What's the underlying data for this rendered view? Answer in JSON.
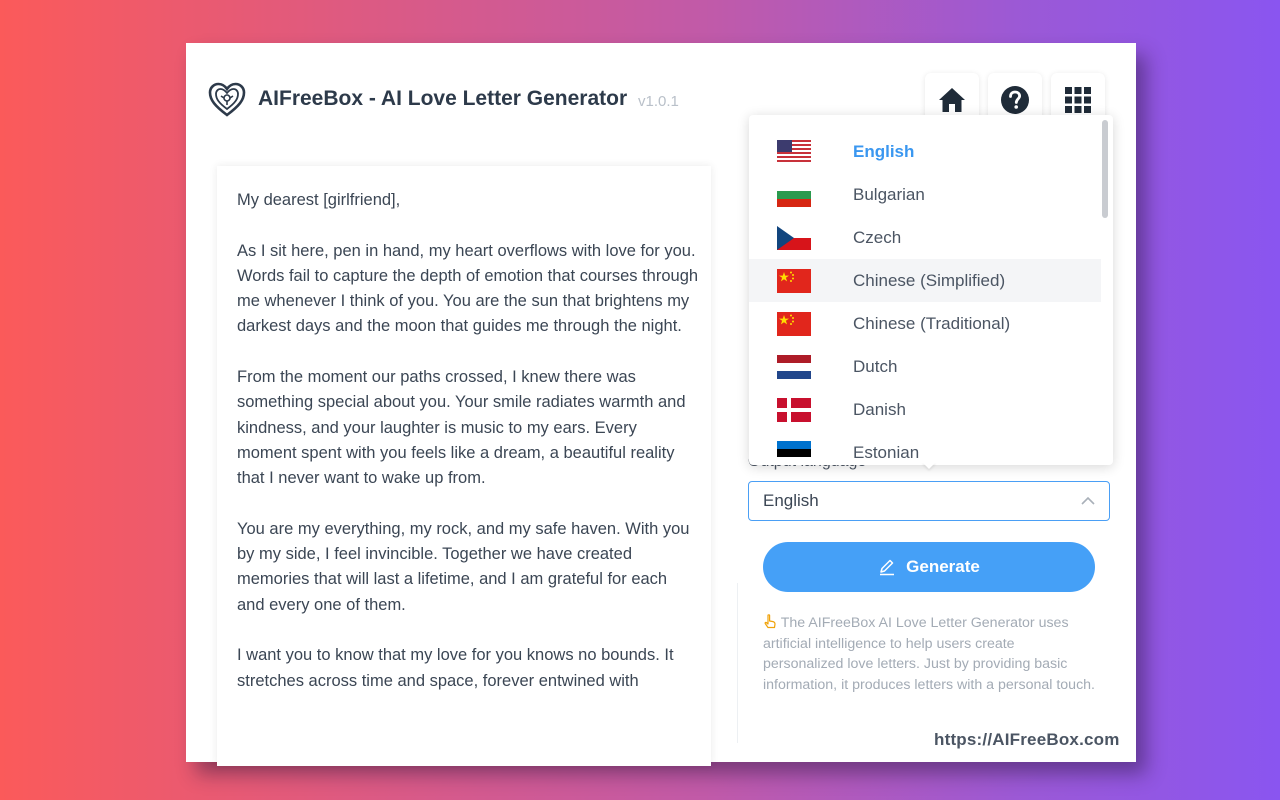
{
  "app": {
    "title": "AIFreeBox - AI Love Letter Generator",
    "version": "v1.0.1",
    "footer_url": "https://AIFreeBox.com"
  },
  "toolbar": {
    "home_icon": "home-icon",
    "help_icon": "help-icon",
    "apps_icon": "apps-grid-icon"
  },
  "letter": {
    "paragraphs": [
      "My dearest [girlfriend],",
      "As I sit here, pen in hand, my heart overflows with love for you. Words fail to capture the depth of emotion that courses through me whenever I think of you. You are the sun that brightens my darkest days and the moon that guides me through the night.",
      "From the moment our paths crossed, I knew there was something special about you. Your smile radiates warmth and kindness, and your laughter is music to my ears. Every moment spent with you feels like a dream, a beautiful reality that I never want to wake up from.",
      "You are my everything, my rock, and my safe haven. With you by my side, I feel invincible. Together we have created memories that will last a lifetime, and I am grateful for each and every one of them.",
      "I want you to know that my love for you knows no bounds. It stretches across time and space, forever entwined with"
    ]
  },
  "output_language": {
    "label": "Output language",
    "selected": "English"
  },
  "generate_button": {
    "label": "Generate"
  },
  "description": "The AIFreeBox AI Love Letter Generator uses artificial intelligence to help users create personalized love letters. Just by providing basic information, it produces letters with a personal touch.",
  "dropdown": {
    "options": [
      {
        "label": "English",
        "flag": "us-flag",
        "selected": true
      },
      {
        "label": "Bulgarian",
        "flag": "bulgaria-flag"
      },
      {
        "label": "Czech",
        "flag": "czech-flag"
      },
      {
        "label": "Chinese (Simplified)",
        "flag": "china-flag",
        "hover": true
      },
      {
        "label": "Chinese (Traditional)",
        "flag": "china-flag"
      },
      {
        "label": "Dutch",
        "flag": "netherlands-flag"
      },
      {
        "label": "Danish",
        "flag": "denmark-flag"
      },
      {
        "label": "Estonian",
        "flag": "estonia-flag"
      }
    ]
  },
  "colors": {
    "accent": "#45a0f7",
    "selected_text": "#3a97f0",
    "title_text": "#2d3a4a"
  }
}
